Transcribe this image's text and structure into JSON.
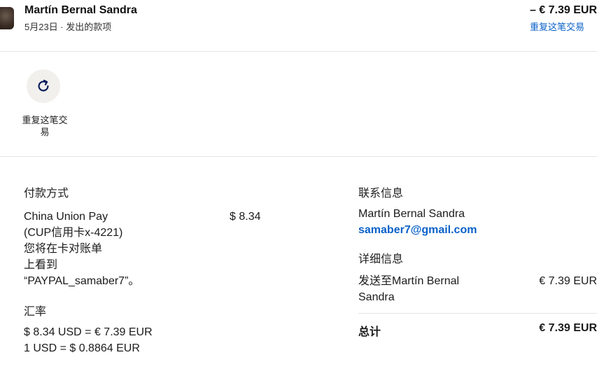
{
  "header": {
    "merchant": "Martín Bernal Sandra",
    "subtitle": "5月23日 · 发出的款项",
    "amount": "– € 7.39 EUR",
    "repeat_link": "重复这笔交易"
  },
  "actions": {
    "repeat_label": "重复这笔交易",
    "icon": "refresh-icon"
  },
  "payment": {
    "title": "付款方式",
    "method_lines": [
      "China Union Pay",
      "(CUP信用卡x-4221)",
      "您将在卡对账单",
      "上看到",
      "“PAYPAL_samaber7”。"
    ],
    "amount": "$ 8.34"
  },
  "exchange": {
    "title": "汇率",
    "line1": "$ 8.34 USD = € 7.39 EUR",
    "line2": "1 USD = $ 0.8864 EUR"
  },
  "contact": {
    "title": "联系信息",
    "name": "Martín Bernal Sandra",
    "email": "samaber7@gmail.com"
  },
  "details": {
    "title": "详细信息",
    "sent_to_line1": "发送至Martín Bernal",
    "sent_to_line2": "Sandra",
    "sent_amount": "€ 7.39 EUR",
    "total_label": "总计",
    "total_amount": "€ 7.39 EUR"
  },
  "colors": {
    "link": "#0a61c9",
    "divider": "#e6e6e6",
    "button_bg": "#f2f0ec"
  }
}
